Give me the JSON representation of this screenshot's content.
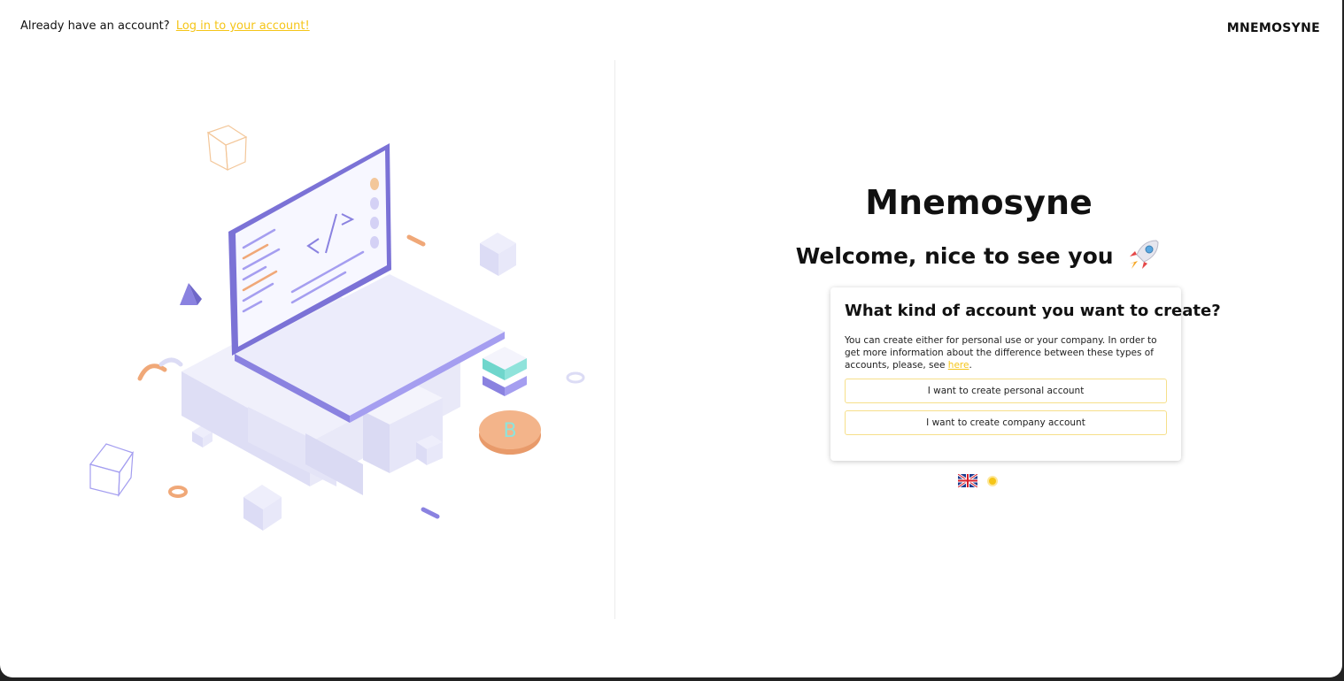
{
  "header": {
    "prompt_text": "Already have an account?",
    "login_link": "Log in to your account!",
    "brand": "MNEMOSYNE"
  },
  "main": {
    "app_title": "Mnemosyne",
    "welcome": "Welcome, nice to see you",
    "welcome_icon": "rocket-icon"
  },
  "card": {
    "title": "What kind of account you want to create?",
    "description": "You can create either for personal use or your company. In order to get more information about the difference between these types of accounts, please, see",
    "here_link": "here",
    "period": ".",
    "personal_button": "I want to create personal account",
    "company_button": "I want to create company account"
  },
  "footer_icons": {
    "language": "uk-flag-icon",
    "theme": "sun-icon"
  },
  "colors": {
    "accent": "#f5c518",
    "illustration_purple": "#7b72d6",
    "illustration_orange": "#f0a878",
    "illustration_teal": "#6fd6cc"
  }
}
